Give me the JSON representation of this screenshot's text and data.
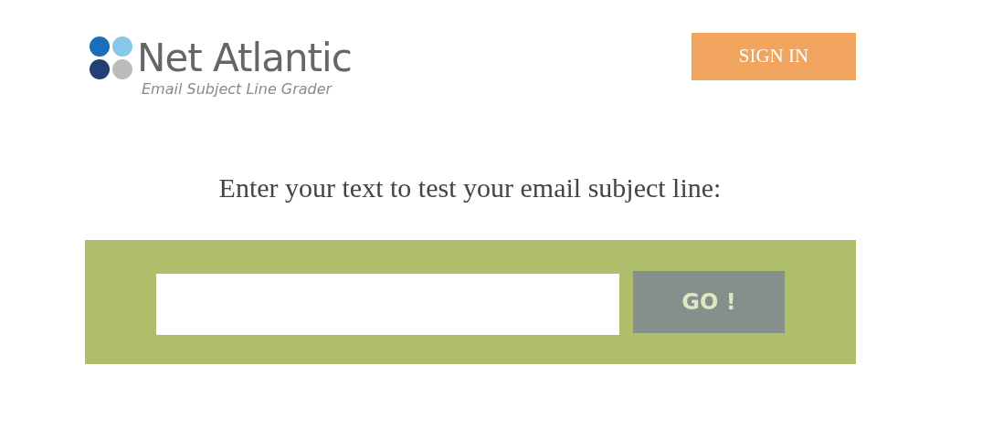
{
  "logo": {
    "name": "Net Atlantic",
    "tagline": "Email Subject Line Grader"
  },
  "header": {
    "sign_in": "SIGN IN"
  },
  "prompt": "Enter your text to test your email subject line:",
  "form": {
    "submit": "GO !"
  }
}
